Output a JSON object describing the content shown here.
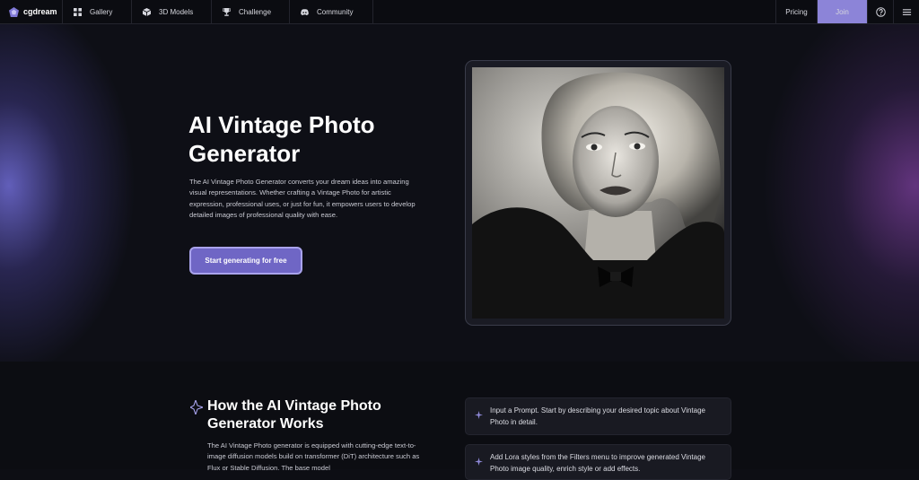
{
  "nav": {
    "logo_text": "cgdream",
    "items": [
      {
        "label": "Gallery",
        "icon": "grid-icon"
      },
      {
        "label": "3D Models",
        "icon": "cube-icon"
      },
      {
        "label": "Challenge",
        "icon": "trophy-icon"
      },
      {
        "label": "Community",
        "icon": "discord-icon"
      }
    ],
    "pricing_label": "Pricing",
    "join_label": "Join",
    "help_icon": "help-icon",
    "menu_icon": "hamburger-menu-icon"
  },
  "hero": {
    "title": "AI Vintage Photo Generator",
    "description": "The AI Vintage Photo Generator converts your dream ideas into amazing visual representations. Whether crafting a Vintage Photo for artistic expression, professional uses, or just for fun, it empowers users to develop detailed images of professional quality with ease.",
    "cta_label": "Start generating for free",
    "image_subject": "vintage black-and-white portrait of a woman"
  },
  "how": {
    "title": "How the AI Vintage Photo Generator Works",
    "description": "The AI Vintage Photo generator is equipped with cutting-edge text-to-image diffusion models build on transformer (DiT) architecture such as Flux or Stable Diffusion. The base model",
    "steps": [
      {
        "text": "Input a Prompt. Start by describing your desired topic about Vintage Photo in detail."
      },
      {
        "text": "Add Lora styles from the Filters menu to improve generated Vintage Photo image quality, enrich style or add effects."
      }
    ]
  },
  "colors": {
    "accent": "#8c84d8",
    "cta_bg": "#6f66c5",
    "background": "#0d0e14"
  }
}
